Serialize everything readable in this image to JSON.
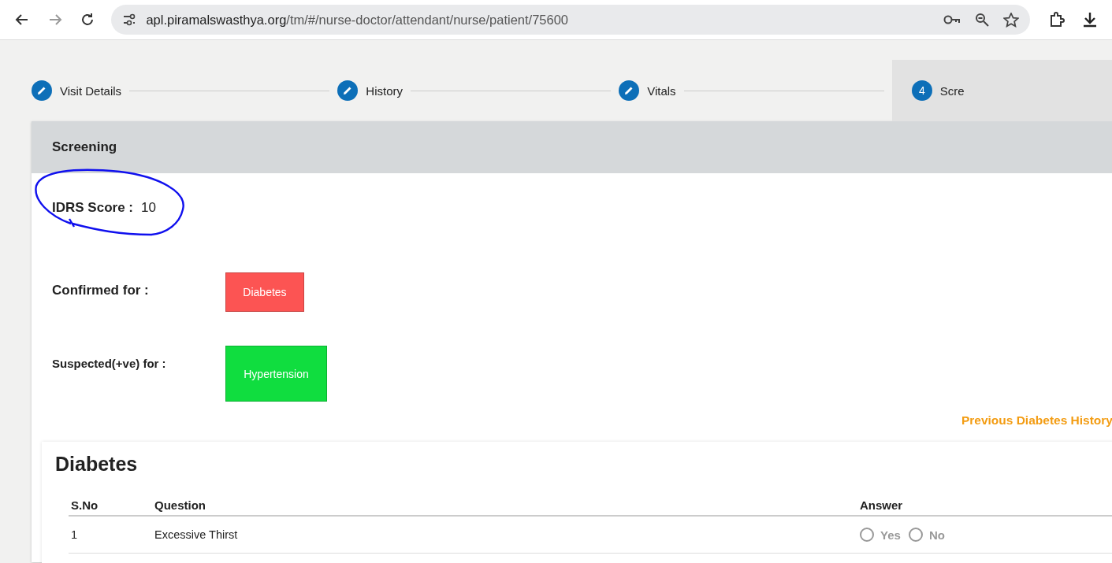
{
  "browser": {
    "url_host": "apl.piramalswasthya.org",
    "url_path": "/tm/#/nurse-doctor/attendant/nurse/patient/75600"
  },
  "stepper": [
    {
      "label": "Visit Details",
      "kind": "done",
      "selected": false
    },
    {
      "label": "History",
      "kind": "done",
      "selected": false
    },
    {
      "label": "Vitals",
      "kind": "done",
      "selected": false
    },
    {
      "label": "Scre",
      "kind": "current",
      "number": "4",
      "selected": true
    }
  ],
  "screening": {
    "title": "Screening",
    "idrs_label": "IDRS Score :",
    "idrs_value": "10",
    "confirmed_label": "Confirmed for :",
    "confirmed": [
      {
        "label": "Diabetes",
        "color": "#fc5453"
      }
    ],
    "suspected_label": "Suspected(+ve) for :",
    "suspected": [
      {
        "label": "Hypertension",
        "color": "#10dd3f"
      }
    ],
    "history_link": "Previous Diabetes History"
  },
  "diabetes": {
    "title": "Diabetes",
    "columns": [
      "S.No",
      "Question",
      "Answer"
    ],
    "rows": [
      {
        "sno": "1",
        "question": "Excessive Thirst",
        "options": [
          {
            "label": "Yes",
            "selected": false
          },
          {
            "label": "No",
            "selected": false
          }
        ]
      }
    ]
  }
}
